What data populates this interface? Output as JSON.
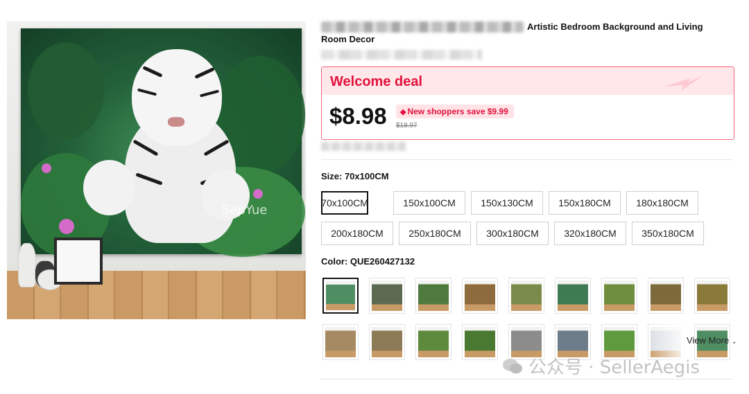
{
  "product": {
    "title_line1": "Artistic Bedroom Background and Living",
    "title_line2": "Room Decor",
    "image_watermark": "SepYue"
  },
  "deal": {
    "title": "Welcome deal",
    "price": "$8.98",
    "save_text": "New shoppers save $9.99",
    "original_price": "$18.97",
    "accent_color": "#e3123c",
    "header_bg": "#ffe7ea"
  },
  "size": {
    "label": "Size: 70x100CM",
    "selected": "70x100CM",
    "options": [
      "70x100CM",
      "150x100CM",
      "150x130CM",
      "150x180CM",
      "180x180CM",
      "200x180CM",
      "250x180CM",
      "300x180CM",
      "320x180CM",
      "350x180CM"
    ]
  },
  "color": {
    "label": "Color: QUE260427132",
    "view_more": "View More",
    "swatch_count": 18,
    "swatch_palette": [
      "#4f8d63",
      "#5d6a52",
      "#4f7a3d",
      "#8d6b3c",
      "#7a8a4a",
      "#3e7a52",
      "#6e8e3e",
      "#7c6a3a",
      "#8a7a3a",
      "#a58a63",
      "#8d7b58",
      "#5e8a3e",
      "#4a7a32",
      "#8c8c8c",
      "#6e7d8a",
      "#5f9a3f",
      "#d9dde3"
    ]
  },
  "overlay_watermark": "公众号 · SellerAegis"
}
